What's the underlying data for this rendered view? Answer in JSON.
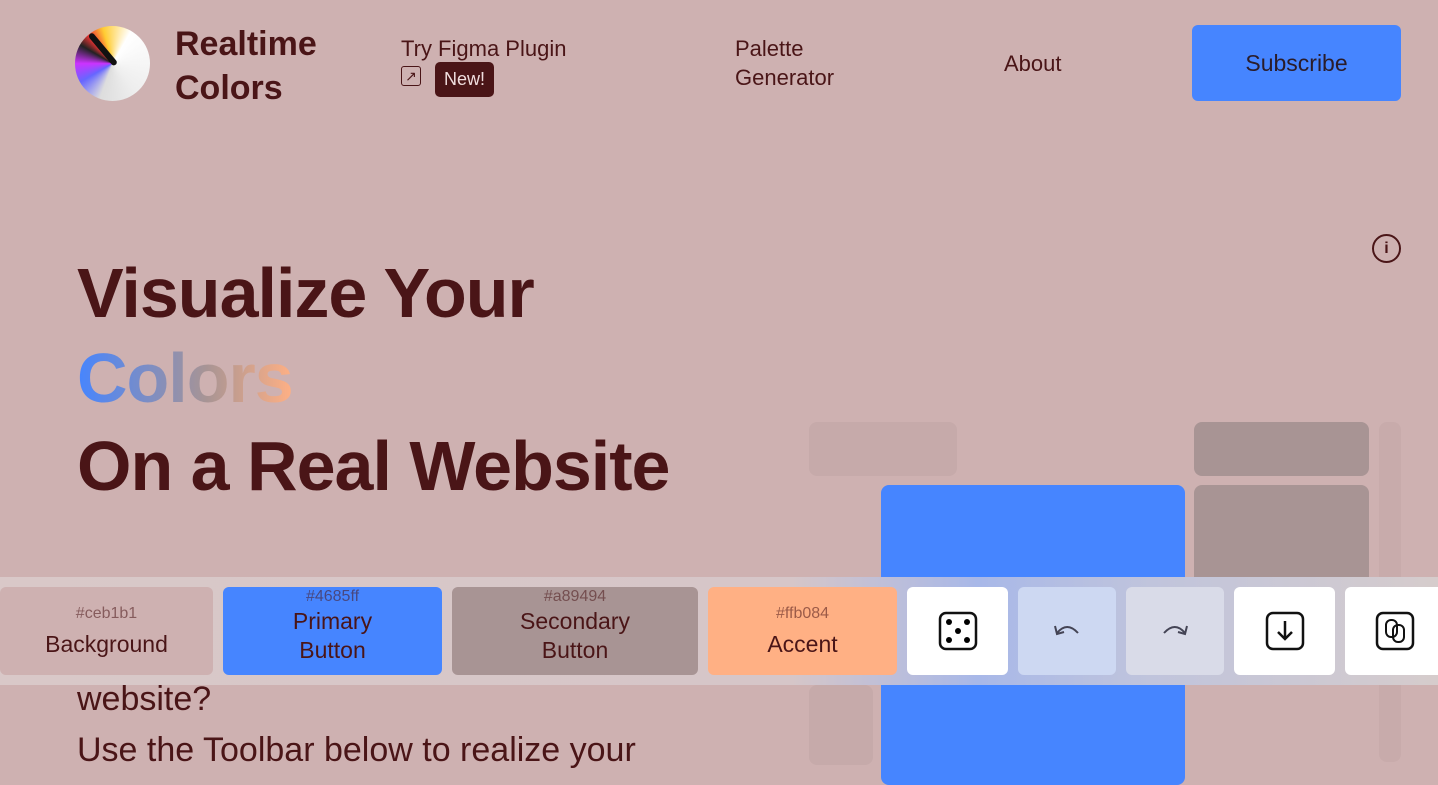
{
  "header": {
    "brand": "Realtime Colors",
    "brand_line1": "Realtime",
    "brand_line2": "Colors",
    "nav": [
      {
        "label": "Try Figma Plugin",
        "badge": "New!",
        "icon": "external-link-icon"
      },
      {
        "label_line1": "Palette",
        "label_line2": "Generator"
      },
      {
        "label": "About"
      }
    ],
    "subscribe": "Subscribe"
  },
  "hero": {
    "line1": "Visualize Your",
    "line2": "Colors",
    "line3": "On a Real Website",
    "body1": "website?",
    "body2": "Use the Toolbar below to realize your"
  },
  "info_icon": "i",
  "toolbar": {
    "colors": [
      {
        "hex": "#ceb1b1",
        "label": "Background"
      },
      {
        "hex": "#4685ff",
        "label": "Primary Button",
        "l1": "Primary",
        "l2": "Button"
      },
      {
        "hex": "#a89494",
        "label": "Secondary Button",
        "l1": "Secondary",
        "l2": "Button"
      },
      {
        "hex": "#ffb084",
        "label": "Accent"
      }
    ],
    "actions": [
      "dice-icon",
      "undo-icon",
      "redo-icon",
      "download-icon",
      "copy-icon"
    ]
  },
  "colors": {
    "text": "#4a1517",
    "background": "#ceb1b1",
    "primary": "#4685ff",
    "secondary": "#a89494",
    "accent": "#ffb084"
  }
}
